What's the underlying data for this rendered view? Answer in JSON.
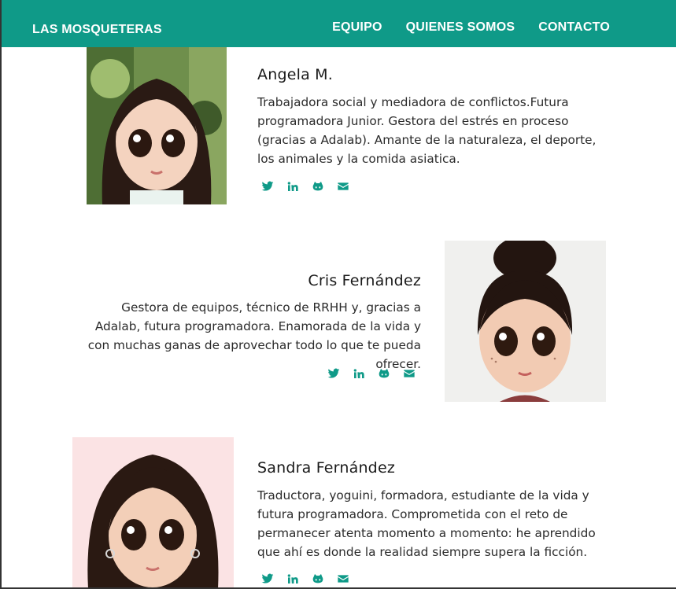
{
  "header": {
    "brand": "LAS MOSQUETERAS",
    "nav": [
      "EQUIPO",
      "QUIENES SOMOS",
      "CONTACTO"
    ]
  },
  "members": [
    {
      "name": "Angela M.",
      "description": "Trabajadora social y mediadora de conflictos.Futura programadora Junior. Gestora del estrés en proceso (gracias a Adalab). Amante de la naturaleza, el deporte, los animales y la comida asiatica."
    },
    {
      "name": "Cris Fernández",
      "description": "Gestora de equipos, técnico de RRHH y, gracias a Adalab, futura programadora. Enamorada de la vida y con muchas ganas de aprovechar todo lo que te pueda ofrecer."
    },
    {
      "name": "Sandra Fernández",
      "description": "Traductora, yoguini, formadora, estudiante de la vida y futura programadora. Comprometida con el reto de permanecer atenta momento a momento: he aprendido que ahí es donde la realidad siempre supera la ficción."
    }
  ],
  "social_icons": [
    "twitter-icon",
    "linkedin-icon",
    "github-icon",
    "envelope-icon"
  ],
  "colors": {
    "accent": "#0f9a88"
  }
}
